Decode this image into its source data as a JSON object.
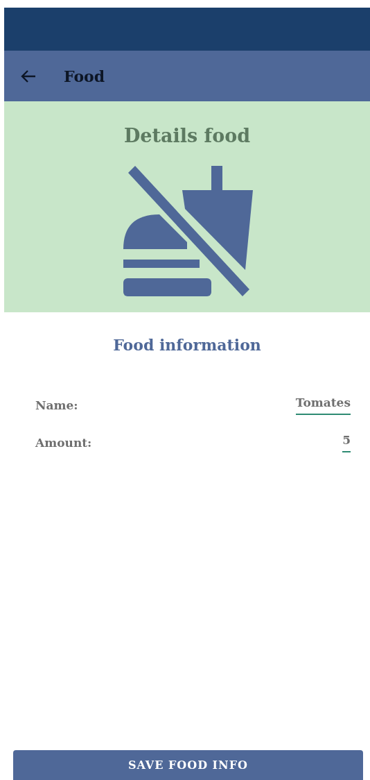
{
  "app_bar": {
    "title": "Food"
  },
  "header": {
    "title": "Details food"
  },
  "section": {
    "title": "Food information"
  },
  "fields": [
    {
      "label": "Name:",
      "value": "Tomates"
    },
    {
      "label": "Amount:",
      "value": "5"
    }
  ],
  "buttons": [
    {
      "label": "SAVE FOOD INFO"
    }
  ]
}
